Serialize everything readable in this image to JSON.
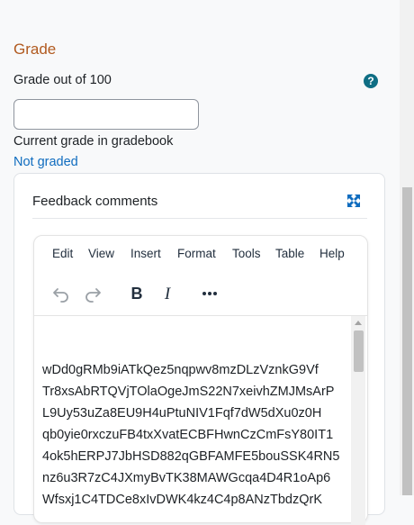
{
  "grade": {
    "heading": "Grade",
    "out_of_label": "Grade out of 100",
    "help_icon": "?",
    "input_value": "",
    "current_label": "Current grade in gradebook",
    "current_value": "Not graded"
  },
  "feedback": {
    "title": "Feedback comments",
    "menu": [
      "Edit",
      "View",
      "Insert",
      "Format",
      "Tools",
      "Table",
      "Help"
    ],
    "toolbar_icons": [
      "undo-icon",
      "redo-icon",
      "bold-icon",
      "italic-icon",
      "more-icon"
    ],
    "content_lines": [
      "wDd0gRMb9iATkQez5nqpwv8mzDLzVznkG9Vf",
      "Tr8xsAbRTQVjTOlaOgeJmS22N7xeivhZMJMsArP",
      "L9Uy53uZa8EU9H4uPtuNIV1Fqf7dW5dXu0z0H",
      "qb0yie0rxczuFB4txXvatECBFHwnCzCmFsY80IT1",
      "4ok5hERPJ7JbHSD882qGBFAMFE5bouSSK4RN5",
      "nz6u3R7zC4JXmyBvTK38MAWGcqa4D4R1oAp6",
      "Wfsxj1C4TDCe8xIvDWK4kz4C4p8ANzTbdzQrK"
    ]
  },
  "colors": {
    "heading": "#b15a1f",
    "link": "#0f6cbf",
    "help": "#0f6e84",
    "expand": "#0f6cbf"
  }
}
